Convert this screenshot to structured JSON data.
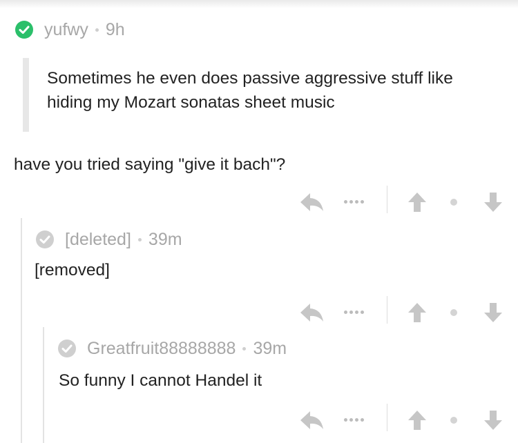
{
  "colors": {
    "verified_green": "#2bbf6a",
    "deleted_gray": "#cfcfcf",
    "meta_text": "#a7a7a7",
    "body_text": "#222222",
    "icon_gray": "#c6c6c6"
  },
  "comments": [
    {
      "username": "yufwy",
      "age": "9h",
      "avatar_icon": "verified-check-icon",
      "quote": "Sometimes he even does passive aggressive stuff like hiding my Mozart sonatas sheet music",
      "body": "have you tried saying \"give it bach\"?"
    },
    {
      "username": "[deleted]",
      "age": "39m",
      "avatar_icon": "check-circle-icon",
      "body": "[removed]"
    },
    {
      "username": "Greatfruit88888888",
      "age": "39m",
      "avatar_icon": "check-circle-icon",
      "body": "So funny I cannot Handel it"
    }
  ],
  "action_icons": [
    "reply-arrow-icon",
    "more-dots-icon",
    "upvote-arrow-icon",
    "vote-dot-icon",
    "downvote-arrow-icon"
  ]
}
